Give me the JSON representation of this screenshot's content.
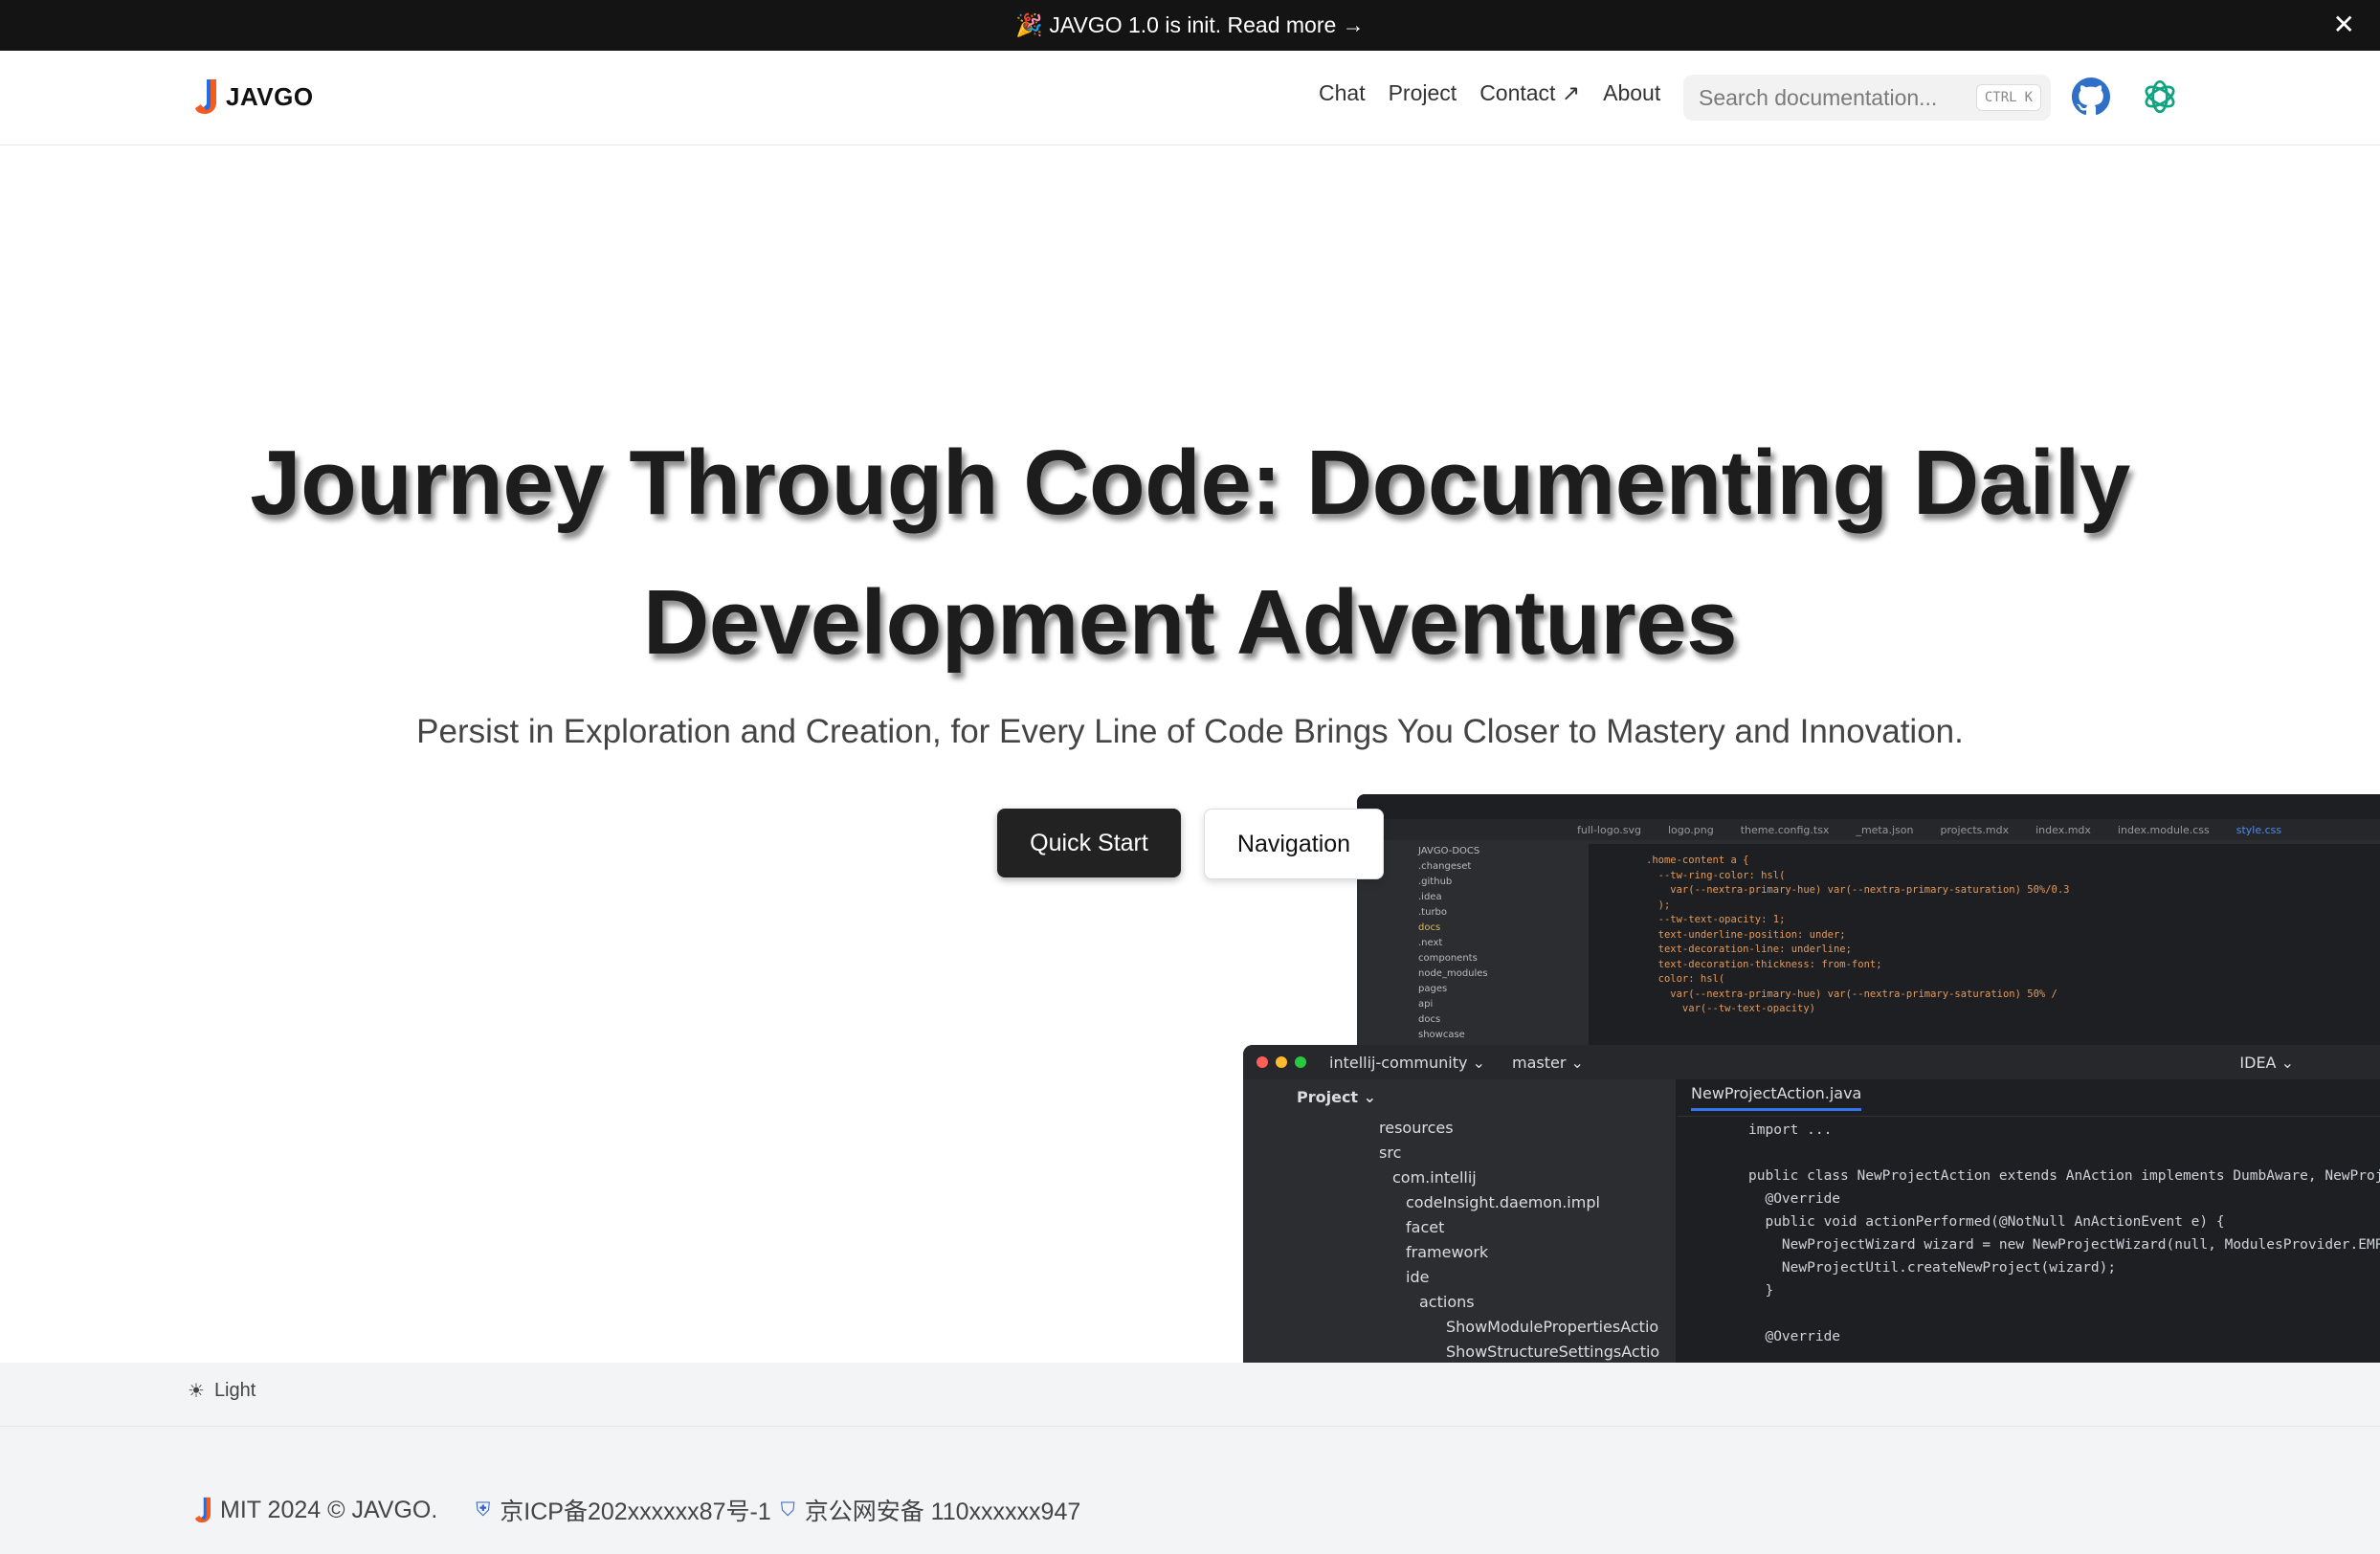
{
  "banner": {
    "text": "🎉 JAVGO 1.0 is init. Read more →",
    "close": "✕"
  },
  "header": {
    "brand": "JAVGO",
    "nav": [
      "Chat",
      "Project",
      "Contact ↗",
      "About"
    ],
    "search": {
      "placeholder": "Search documentation...",
      "shortcut_ctrl": "CTRL",
      "shortcut_key": "K"
    }
  },
  "hero": {
    "title_line1": "Journey Through Code: Documenting Daily",
    "title_line2": "Development Adventures",
    "subtitle": "Persist in Exploration and Creation, for Every Line of Code Brings You Closer to Mastery and Innovation.",
    "primary_button": "Quick Start",
    "secondary_button": "Navigation"
  },
  "screenshot_back": {
    "tabs": [
      "full-logo.svg",
      "logo.png",
      "theme.config.tsx",
      "_meta.json",
      "projects.mdx",
      "index.mdx",
      "index.module.css",
      "style.css"
    ],
    "tree": [
      "JAVGO-DOCS",
      ".changeset",
      ".github",
      ".idea",
      ".turbo",
      "docs",
      ".next",
      "components",
      "node_modules",
      "pages",
      "api",
      "docs",
      "showcase"
    ],
    "code": ".home-content a {\n  --tw-ring-color: hsl(\n    var(--nextra-primary-hue) var(--nextra-primary-saturation) 50%/0.3\n  );\n  --tw-text-opacity: 1;\n  text-underline-position: under;\n  text-decoration-line: underline;\n  text-decoration-thickness: from-font;\n  color: hsl(\n    var(--nextra-primary-hue) var(--nextra-primary-saturation) 50% /\n      var(--tw-text-opacity)"
  },
  "screenshot_front": {
    "project_name": "intellij-community ⌄",
    "branch": "master ⌄",
    "run_config": "IDEA ⌄",
    "panel_title": "Project ⌄",
    "tree": [
      "resources",
      "src",
      "com.intellij",
      "codeInsight.daemon.impl",
      "facet",
      "framework",
      "ide",
      "actions",
      "ShowModulePropertiesActio",
      "ShowStructureSettingsActio"
    ],
    "file_tab": "NewProjectAction.java",
    "code": "import ...\n\npublic class NewProjectAction extends AnAction implements DumbAware, NewProjec\n  @Override\n  public void actionPerformed(@NotNull AnActionEvent e) {\n    NewProjectWizard wizard = new NewProjectWizard(null, ModulesProvider.EMPTY\n    NewProjectUtil.createNewProject(wizard);\n  }\n\n  @Override"
  },
  "footer": {
    "theme_label": "Light",
    "copyright": "MIT 2024 © JAVGO.",
    "icp": "京ICP备202xxxxxx87号-1",
    "police": "京公网安备 110xxxxxx947"
  },
  "colors": {
    "brand_orange": "#f55a1f",
    "brand_blue": "#1f6feb",
    "github_blue": "#2f6fc7",
    "openai_green": "#10a37f",
    "dark": "#222222"
  }
}
